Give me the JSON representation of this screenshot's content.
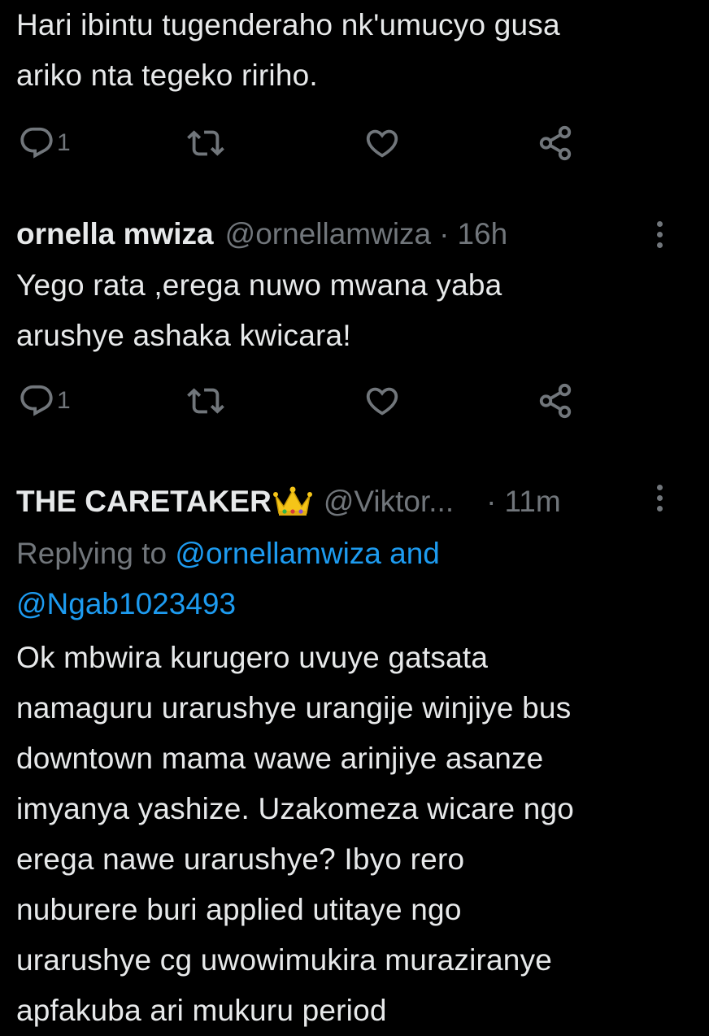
{
  "tweet1": {
    "text_lines": [
      "Hari ibintu tugenderaho nk'umucyo gusa",
      "ariko nta tegeko ririho."
    ],
    "actions": {
      "reply_count": "1"
    }
  },
  "tweet2": {
    "name": "ornella mwiza",
    "handle": "@ornellamwiza",
    "separator": "·",
    "time": "16h",
    "text_lines": [
      "Yego rata ,erega nuwo mwana yaba",
      "arushye ashaka kwicara!"
    ],
    "actions": {
      "reply_count": "1"
    }
  },
  "tweet3": {
    "name": "THE CARETAKER",
    "handle": "@Viktor...",
    "separator": "·",
    "time": "11m",
    "replying_prefix": "Replying to ",
    "replying_mention1": "@ornellamwiza",
    "replying_and": " and",
    "replying_mention2": "@Ngab1023493",
    "text_lines": [
      "Ok mbwira kurugero uvuye gatsata",
      "namaguru urarushye urangije winjiye bus",
      "downtown mama wawe arinjiye asanze",
      "imyanya yashize. Uzakomeza wicare ngo",
      "erega nawe urarushye? Ibyo rero",
      "nuburere buri applied utitaye ngo",
      "urarushye cg uwowimukira muraziranye",
      "apfakuba ari mukuru period"
    ]
  },
  "colors": {
    "background": "#000000",
    "text_primary": "#e7e9ea",
    "text_secondary": "#71767b",
    "link": "#1d9bf0",
    "crown": "#f5c518"
  },
  "icons": [
    "reply-icon",
    "retweet-icon",
    "like-icon",
    "share-icon",
    "more-icon",
    "crown-emoji-icon"
  ]
}
